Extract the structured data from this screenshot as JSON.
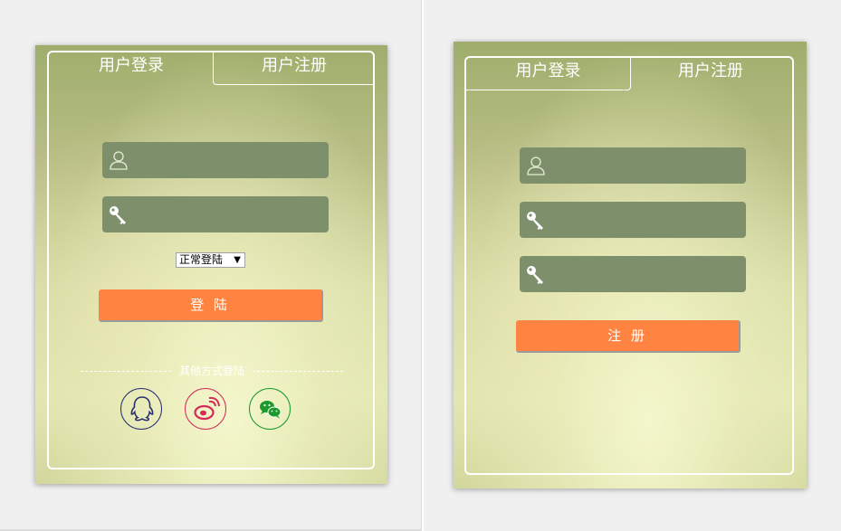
{
  "login_panel": {
    "tabs": [
      {
        "label": "用户登录",
        "active": true
      },
      {
        "label": "用户注册",
        "active": false
      }
    ],
    "username_icon": "user-icon",
    "password_icon": "key-icon",
    "login_mode": {
      "selected": "正常登陆",
      "caret": "▼"
    },
    "login_button": "登 陆",
    "other_methods_label": "其他方式登陆",
    "social": [
      {
        "name": "qq-icon",
        "color": "#2b2f72"
      },
      {
        "name": "weibo-icon",
        "color": "#d52b5b"
      },
      {
        "name": "wechat-icon",
        "color": "#1c9b2c"
      }
    ]
  },
  "register_panel": {
    "tabs": [
      {
        "label": "用户登录",
        "active": false
      },
      {
        "label": "用户注册",
        "active": true
      }
    ],
    "username_icon": "user-icon",
    "password_icon": "key-icon",
    "confirm_password_icon": "key-icon",
    "register_button": "注 册"
  },
  "colors": {
    "input_bg": "#7e906b",
    "button_bg": "#ff8442",
    "card_top": "#9fae6c",
    "card_bottom": "#e3e7b2"
  }
}
